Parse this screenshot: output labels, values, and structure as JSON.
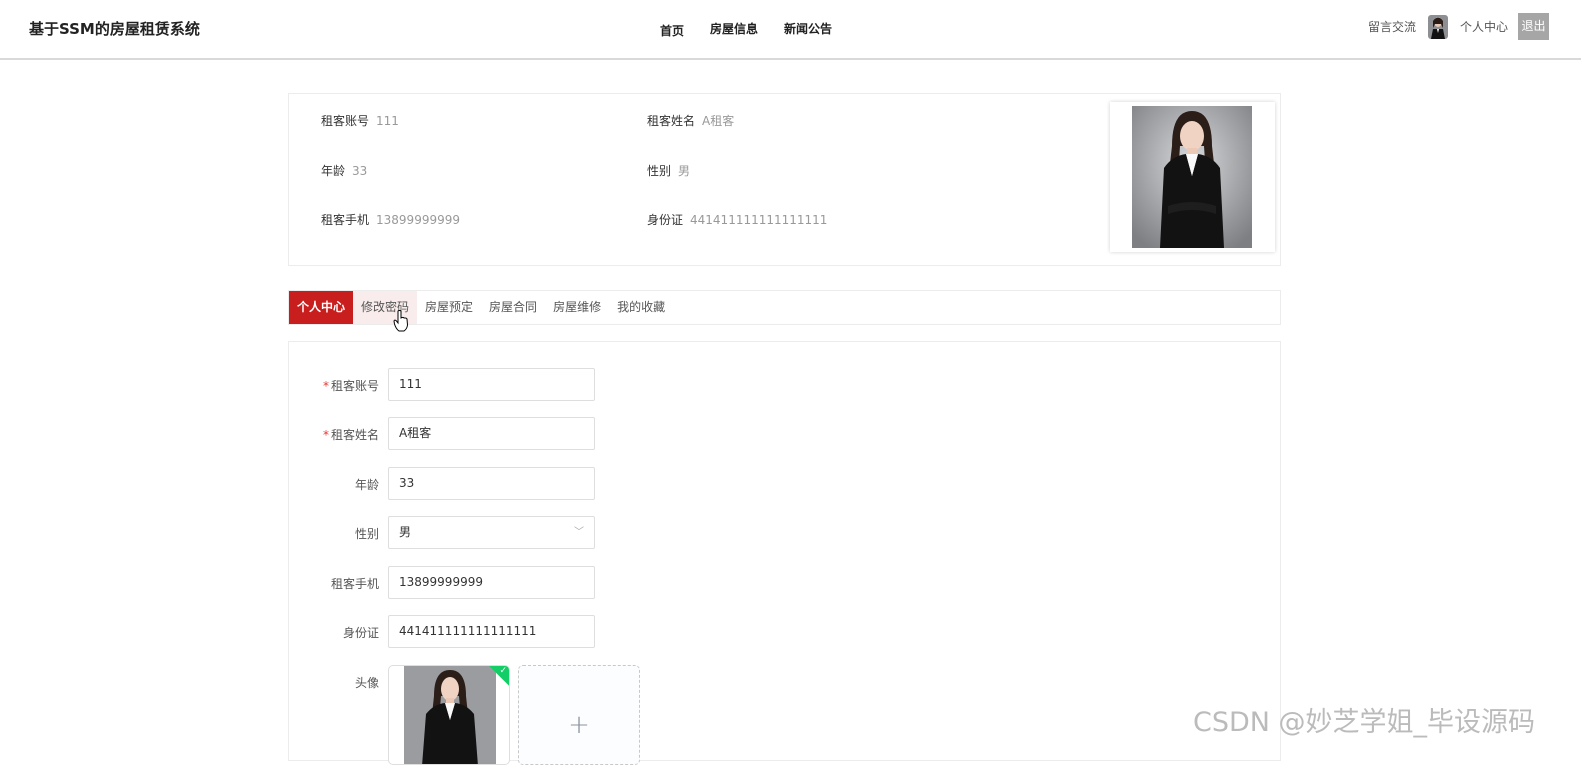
{
  "header": {
    "brand": "基于SSM的房屋租赁系统",
    "nav": [
      "首页",
      "房屋信息",
      "新闻公告"
    ],
    "message_link": "留言交流",
    "profile_link": "个人中心",
    "logout_label": "退出"
  },
  "info": {
    "account_label": "租客账号",
    "account_value": "111",
    "name_label": "租客姓名",
    "name_value": "A租客",
    "age_label": "年龄",
    "age_value": "33",
    "gender_label": "性别",
    "gender_value": "男",
    "phone_label": "租客手机",
    "phone_value": "13899999999",
    "id_label": "身份证",
    "id_value": "441411111111111111"
  },
  "tabs": [
    "个人中心",
    "修改密码",
    "房屋预定",
    "房屋合同",
    "房屋维修",
    "我的收藏"
  ],
  "form": {
    "account": {
      "label": "租客账号",
      "value": "111",
      "required": true
    },
    "name": {
      "label": "租客姓名",
      "value": "A租客",
      "required": true
    },
    "age": {
      "label": "年龄",
      "value": "33"
    },
    "gender": {
      "label": "性别",
      "value": "男"
    },
    "phone": {
      "label": "租客手机",
      "value": "13899999999"
    },
    "idcard": {
      "label": "身份证",
      "value": "441411111111111111"
    },
    "avatar": {
      "label": "头像"
    }
  },
  "watermark": "CSDN @妙芝学姐_毕设源码",
  "colors": {
    "accent": "#c81e1e",
    "success": "#13ce66"
  }
}
